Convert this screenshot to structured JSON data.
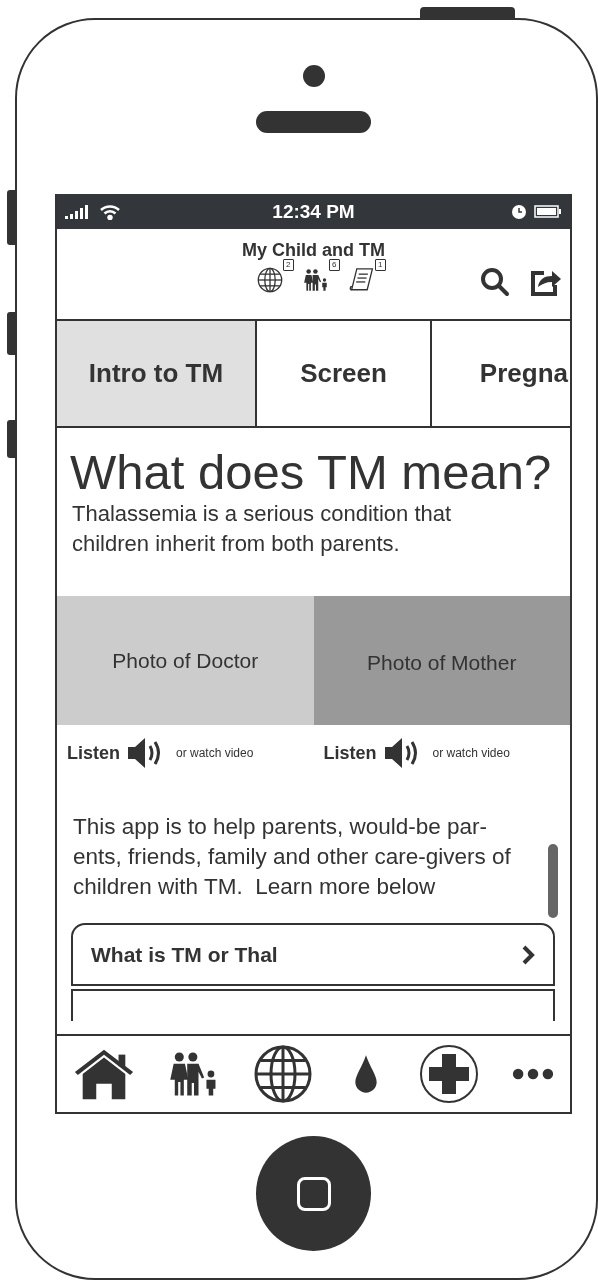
{
  "status_bar": {
    "time": "12:34 PM"
  },
  "header": {
    "title": "My Child and TM",
    "badges": [
      {
        "kind": "globe",
        "count": "2"
      },
      {
        "kind": "family",
        "count": "6"
      },
      {
        "kind": "document",
        "count": "1"
      }
    ]
  },
  "tabs": [
    {
      "label": "Intro to TM",
      "selected": true
    },
    {
      "label": "Screen",
      "selected": false
    },
    {
      "label": "Pregna",
      "selected": false
    }
  ],
  "article": {
    "heading": "What does TM mean?",
    "intro": "Thalassemia is a serious condition that children inherit from both parents."
  },
  "media": [
    {
      "caption": "Photo of Doctor",
      "color": "#cccccc",
      "listen": "Listen",
      "video": "or watch video"
    },
    {
      "caption": "Photo of Mother",
      "color": "#999999",
      "listen": "Listen",
      "video": "or watch video"
    }
  ],
  "body_text": "This app is to help parents, would-be par-ents, friends, family and other care-givers of children with TM.  Learn more below",
  "list": [
    {
      "label": "What is TM or Thal"
    }
  ],
  "bottom_nav": [
    {
      "kind": "home"
    },
    {
      "kind": "family"
    },
    {
      "kind": "globe"
    },
    {
      "kind": "drop"
    },
    {
      "kind": "medical"
    },
    {
      "kind": "more"
    }
  ]
}
